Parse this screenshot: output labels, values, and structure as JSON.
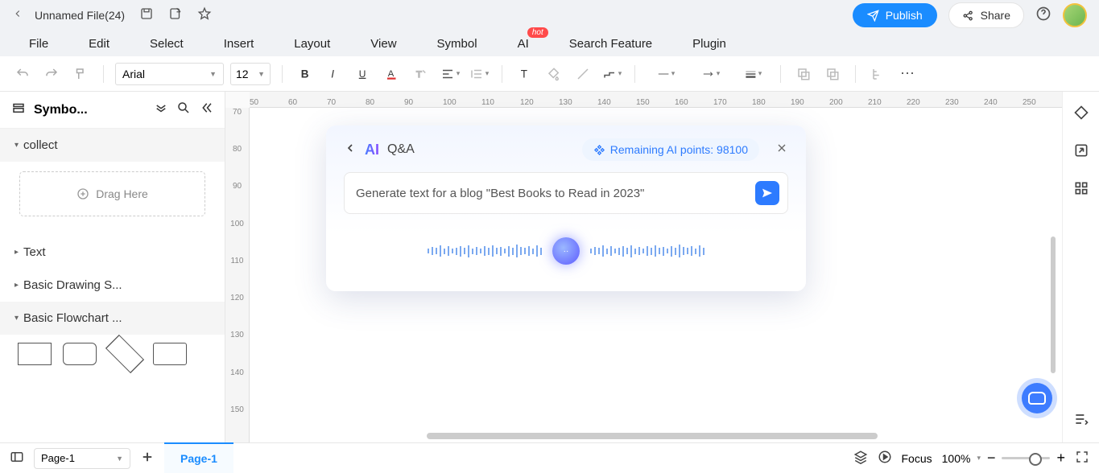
{
  "titlebar": {
    "filename": "Unnamed File(24)",
    "publish": "Publish",
    "share": "Share"
  },
  "menu": {
    "file": "File",
    "edit": "Edit",
    "select": "Select",
    "insert": "Insert",
    "layout": "Layout",
    "view": "View",
    "symbol": "Symbol",
    "ai": "AI",
    "ai_badge": "hot",
    "search": "Search Feature",
    "plugin": "Plugin"
  },
  "toolbar": {
    "font": "Arial",
    "size": "12"
  },
  "sidebar": {
    "title": "Symbo...",
    "sections": {
      "collect": "collect",
      "text": "Text",
      "basic_drawing": "Basic Drawing S...",
      "basic_flowchart": "Basic Flowchart ..."
    },
    "drag_here": "Drag Here"
  },
  "ruler_top": [
    "50",
    "60",
    "70",
    "80",
    "90",
    "100",
    "110",
    "120",
    "130",
    "140",
    "150",
    "160",
    "170",
    "180",
    "190",
    "200",
    "210",
    "220",
    "230",
    "240",
    "250"
  ],
  "ruler_left": [
    "70",
    "80",
    "90",
    "100",
    "110",
    "120",
    "130",
    "140",
    "150"
  ],
  "ai_panel": {
    "qa_label": "Q&A",
    "points_label": "Remaining AI points: 98100",
    "prompt": "Generate text for a blog \"Best Books to Read in 2023\""
  },
  "bottombar": {
    "page_select": "Page-1",
    "page_tab": "Page-1",
    "focus": "Focus",
    "zoom": "100%"
  }
}
